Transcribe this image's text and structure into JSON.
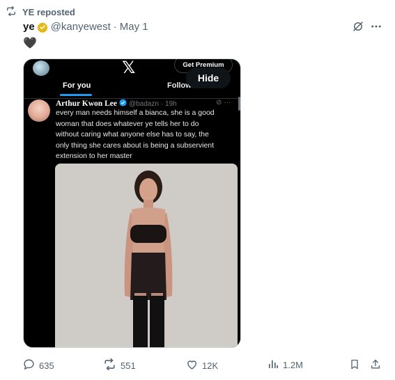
{
  "repost": {
    "label": "YE reposted"
  },
  "tweet": {
    "name": "ye",
    "handle": "@kanyewest",
    "sep": "·",
    "date": "May 1",
    "content_emoji": "🖤"
  },
  "media": {
    "screenshot": {
      "logo": "𝕏",
      "premium_label": "Get Premium",
      "tabs": [
        "For you",
        "Followi"
      ],
      "inner_tweet": {
        "name": "Arthur Kwon Lee",
        "handle": "@badazn",
        "time": "· 19h",
        "text_lines": [
          "every man needs himself a bianca, she is a good",
          "woman that does whatever ye tells her to do",
          "without caring what anyone else has to say, the",
          "only thing she cares about is being a subservient",
          "extension to her master"
        ]
      }
    },
    "hide_label": "Hide"
  },
  "actions": {
    "replies": "635",
    "reposts": "551",
    "likes": "12K",
    "views": "1.2M"
  },
  "colors": {
    "accent": "#1d9bf0",
    "verified_gold": "#e2b719",
    "muted": "#536471"
  }
}
